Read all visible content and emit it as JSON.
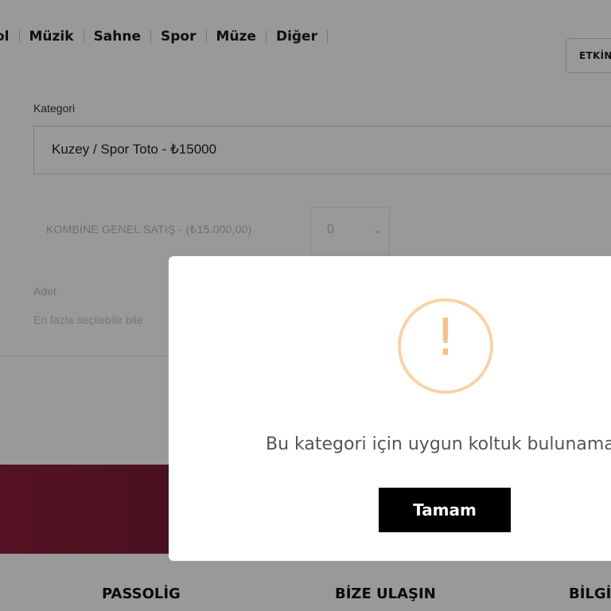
{
  "nav": {
    "items": [
      "ol",
      "Müzik",
      "Sahne",
      "Spor",
      "Müze",
      "Diğer"
    ],
    "event_button_label": "ETKİNL"
  },
  "category": {
    "label": "Kategori",
    "selected_value": "Kuzey / Spor Toto - ₺15000"
  },
  "tickets": {
    "type_label": "KOMBİNE GENEL SATIŞ - (₺15.000,00)",
    "quantity_value": "0"
  },
  "quantity": {
    "label": "Adet",
    "help_text": "En fazla seçilebilir bile"
  },
  "footer": {
    "links": [
      "PASSOLİG",
      "BİZE ULAŞIN",
      "BİLGİ"
    ]
  },
  "modal": {
    "icon": "exclamation-warning-icon",
    "message": "Bu kategori için uygun koltuk bulunamadı",
    "confirm_label": "Tamam"
  },
  "colors": {
    "modal_button": "#000000",
    "warning_icon": "#f8d3a6",
    "promo_band": "#7a1c36",
    "overlay": "rgba(0,0,0,0.40)"
  }
}
